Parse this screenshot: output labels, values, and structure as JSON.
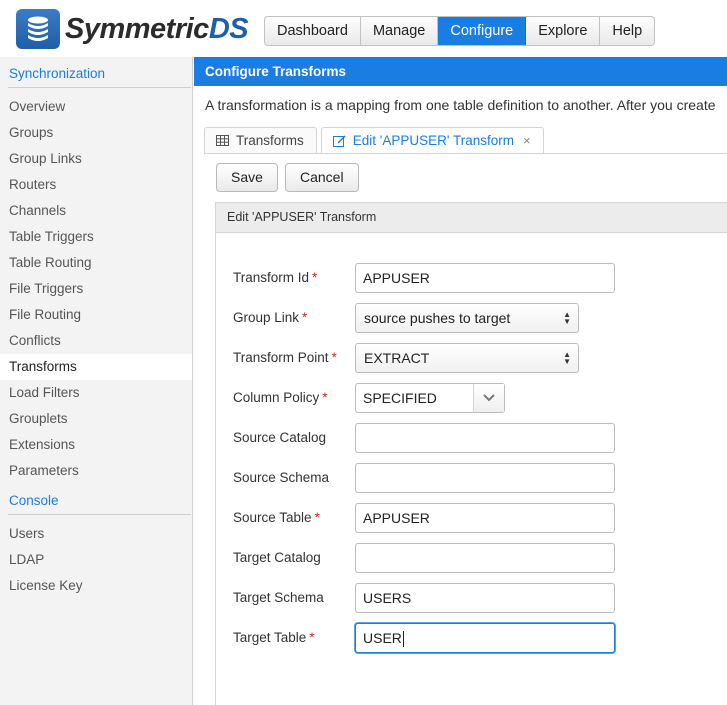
{
  "app": {
    "logo_word": "Symmetric",
    "logo_suffix": "DS"
  },
  "topnav": {
    "items": [
      "Dashboard",
      "Manage",
      "Configure",
      "Explore",
      "Help"
    ],
    "active": "Configure"
  },
  "sidebar": {
    "section_sync": "Synchronization",
    "sync_items": [
      "Overview",
      "Groups",
      "Group Links",
      "Routers",
      "Channels",
      "Table Triggers",
      "Table Routing",
      "File Triggers",
      "File Routing",
      "Conflicts",
      "Transforms",
      "Load Filters",
      "Grouplets",
      "Extensions",
      "Parameters"
    ],
    "selected": "Transforms",
    "section_console": "Console",
    "console_items": [
      "Users",
      "LDAP",
      "License Key"
    ]
  },
  "main": {
    "title": "Configure Transforms",
    "description": "A transformation is a mapping from one table definition to another. After you create",
    "tabs": [
      {
        "label": "Transforms",
        "icon": "table-icon"
      },
      {
        "label": "Edit 'APPUSER' Transform",
        "icon": "edit-icon",
        "close": "×"
      }
    ],
    "save_label": "Save",
    "cancel_label": "Cancel",
    "panel_title": "Edit 'APPUSER' Transform"
  },
  "form": {
    "transform_id": {
      "label": "Transform Id",
      "required": "*",
      "value": "APPUSER"
    },
    "group_link": {
      "label": "Group Link",
      "required": "*",
      "value": "source pushes to target"
    },
    "transform_point": {
      "label": "Transform Point",
      "required": "*",
      "value": "EXTRACT"
    },
    "column_policy": {
      "label": "Column Policy",
      "required": "*",
      "value": "SPECIFIED"
    },
    "source_catalog": {
      "label": "Source Catalog",
      "value": ""
    },
    "source_schema": {
      "label": "Source Schema",
      "value": ""
    },
    "source_table": {
      "label": "Source Table",
      "required": "*",
      "value": "APPUSER"
    },
    "target_catalog": {
      "label": "Target Catalog",
      "value": ""
    },
    "target_schema": {
      "label": "Target Schema",
      "value": "USERS"
    },
    "target_table": {
      "label": "Target Table",
      "required": "*",
      "value": "USER"
    }
  },
  "colors": {
    "accent": "#197de1",
    "required": "#d42424",
    "sidebar_bg": "#f3f3f3"
  }
}
